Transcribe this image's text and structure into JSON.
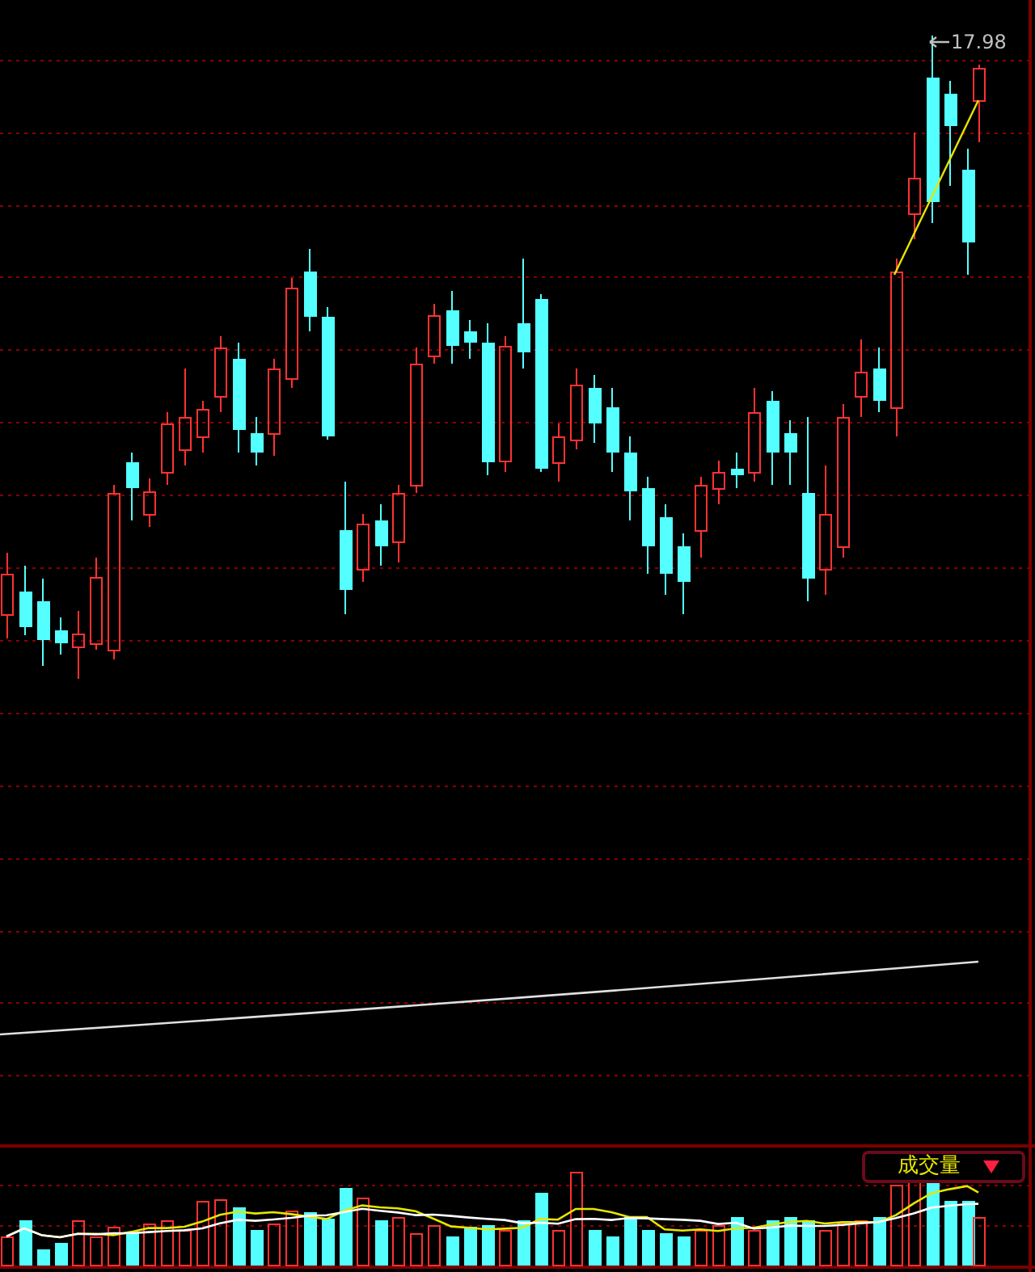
{
  "price_chart": {
    "high_price_label": "17.98"
  },
  "volume_panel": {
    "indicator_selector": {
      "label": "成交量"
    }
  }
}
